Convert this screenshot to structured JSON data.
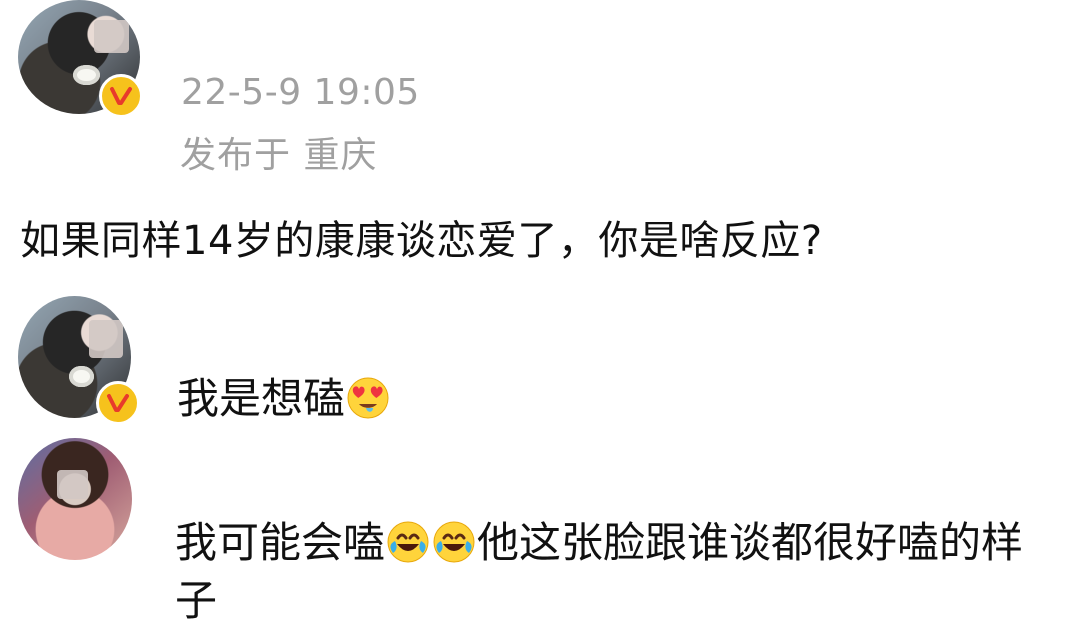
{
  "post": {
    "timestamp": "22-5-9 19:05",
    "location": "发布于 重庆",
    "text": "如果同样14岁的康康谈恋爱了，你是啥反应?"
  },
  "icons": {
    "verified": "verified-badge-icon",
    "heart_eyes": "heart-eyes-emoji-icon",
    "laughing_crying": "laughing-crying-emoji-icon"
  },
  "colors": {
    "metadata": "#a0a0a0",
    "text": "#111111",
    "verified_badge": "#f6c21c"
  },
  "comments": [
    {
      "text": "我是想磕"
    },
    {
      "text_before_emoji": "我可能会嗑",
      "text_after_emoji": "他这张脸跟谁谈都很好嗑的样",
      "text_second_line": "子"
    }
  ]
}
